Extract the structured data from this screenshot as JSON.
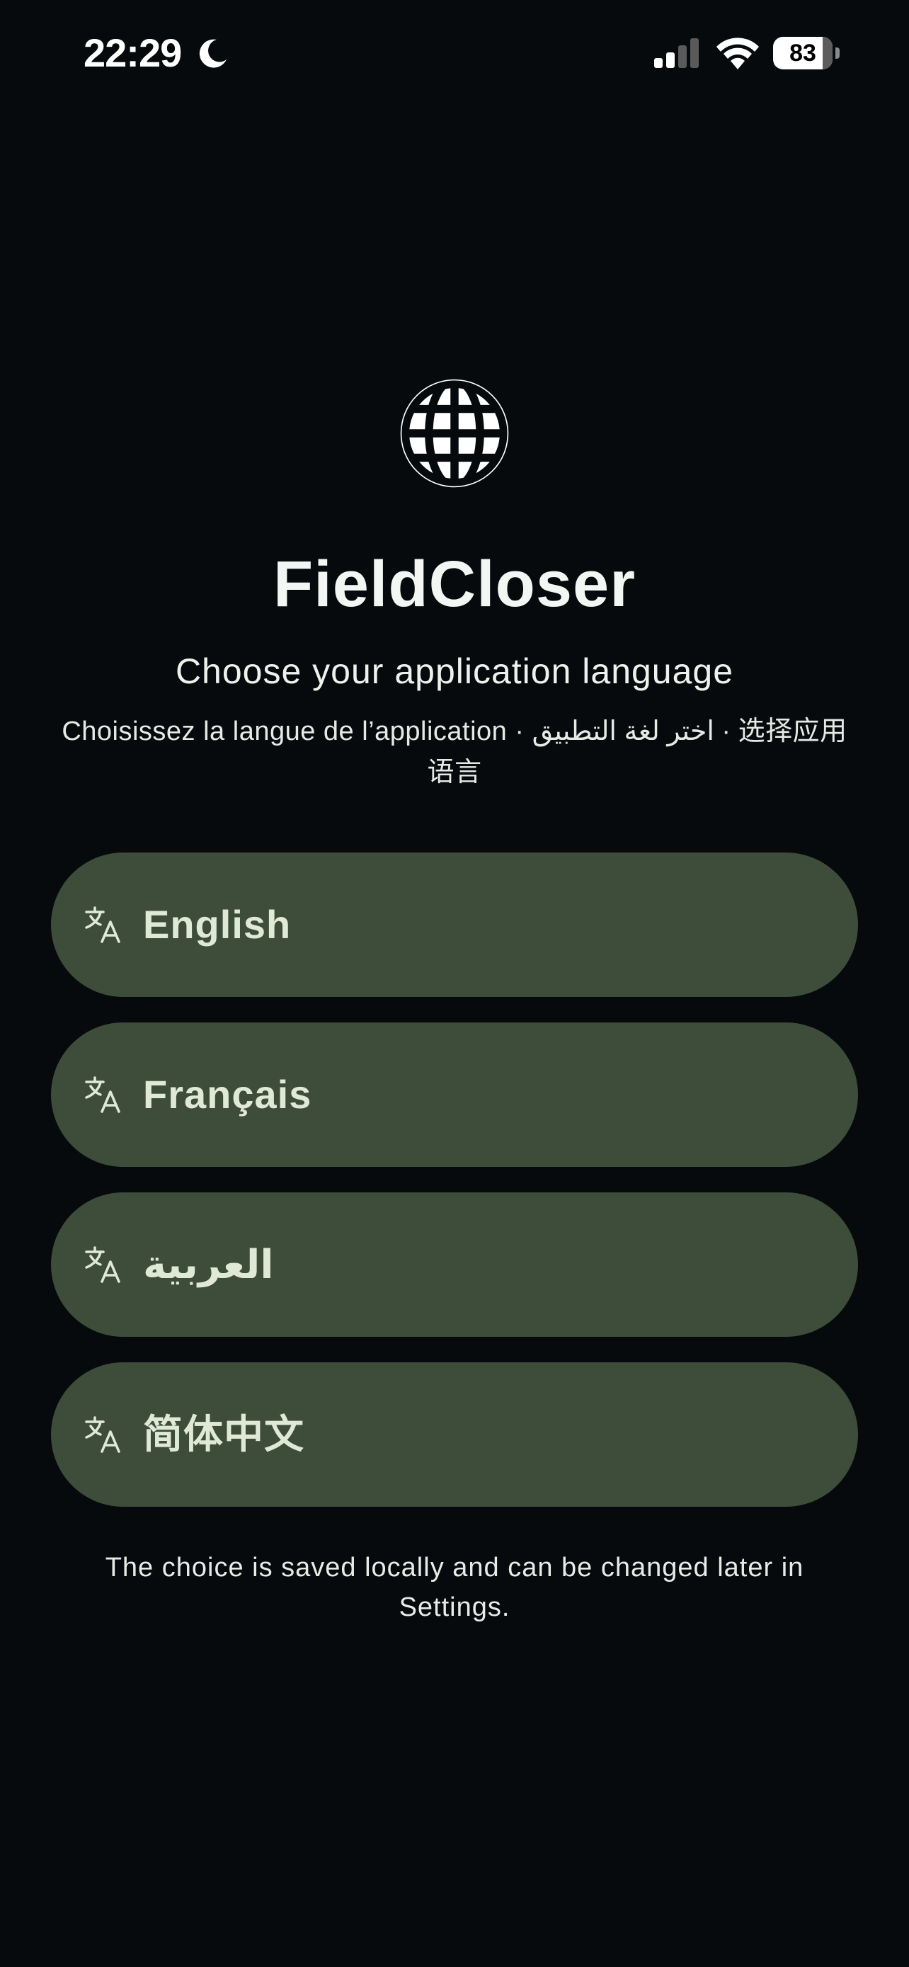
{
  "status_bar": {
    "time": "22:29",
    "battery_level": "83",
    "battery_percent": 83
  },
  "hero": {
    "icon": "globe-icon",
    "app_title": "FieldCloser",
    "subtitle": "Choose your application language",
    "multilingual_subtitle": "Choisissez la langue de l’application · اختر لغة التطبيق · 选择应用语言"
  },
  "languages": [
    {
      "label": "English",
      "icon": "translate-icon"
    },
    {
      "label": "Français",
      "icon": "translate-icon"
    },
    {
      "label": "العربية",
      "icon": "translate-icon"
    },
    {
      "label": "简体中文",
      "icon": "translate-icon"
    }
  ],
  "footer": {
    "note": "The choice is saved locally and can be changed later in Settings."
  },
  "colors": {
    "background": "#060a0d",
    "button_background": "#3d4d3a",
    "button_text": "#dfe9d6",
    "text_primary": "#f3f6f2"
  }
}
